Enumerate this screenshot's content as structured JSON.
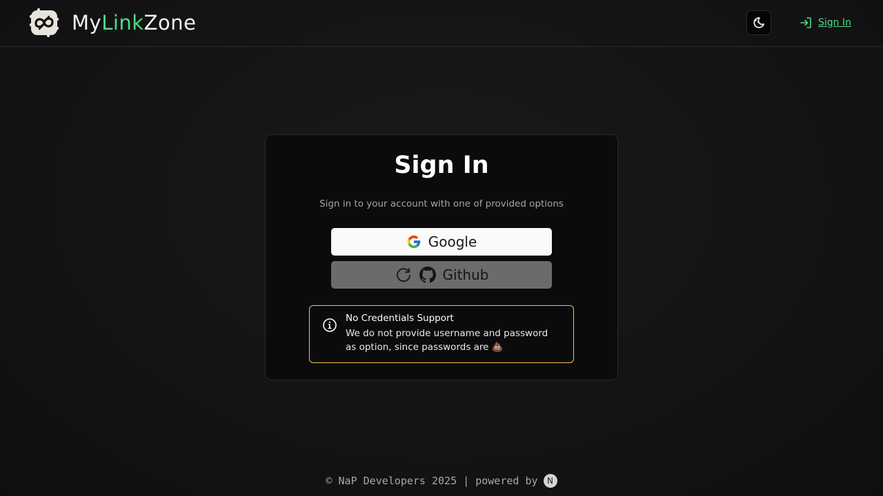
{
  "header": {
    "brand_part1": "My",
    "brand_part2": "Link",
    "brand_part3": "Zone",
    "logo_icon": "link-logo-icon",
    "theme_toggle_icon": "moon-stars-icon",
    "signin_label": "Sign In",
    "signin_icon": "log-in-icon"
  },
  "card": {
    "title": "Sign In",
    "subtitle": "Sign in to your account with one of provided options",
    "google_label": "Google",
    "github_label": "Github",
    "github_loading_icon": "refresh-spinner-icon"
  },
  "notice": {
    "title": "No Credentials Support",
    "body": "We do not provide username and password as option, since passwords are 💩",
    "icon": "info-icon",
    "border_color": "#f5c451"
  },
  "footer": {
    "text": "© NaP Developers 2025 | powered by",
    "badge": "N"
  },
  "colors": {
    "accent": "#4ade80",
    "background": "#141416"
  }
}
